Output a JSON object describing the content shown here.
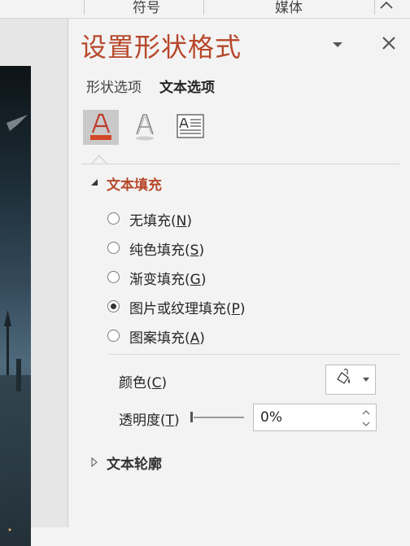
{
  "ribbon": {
    "group_symbols": "符号",
    "group_media": "媒体"
  },
  "pane": {
    "title": "设置形状格式",
    "tabs": [
      {
        "label": "形状选项",
        "active": false
      },
      {
        "label": "文本选项",
        "active": true
      }
    ],
    "icons": [
      "text-fill-outline-icon",
      "text-effects-icon",
      "textbox-icon"
    ],
    "accent_color": "#b7472a",
    "sections": {
      "text_fill": {
        "title": "文本填充",
        "expanded": true,
        "options": [
          {
            "label": "无填充",
            "key": "N",
            "selected": false
          },
          {
            "label": "纯色填充",
            "key": "S",
            "selected": false
          },
          {
            "label": "渐变填充",
            "key": "G",
            "selected": false
          },
          {
            "label": "图片或纹理填充",
            "key": "P",
            "selected": true
          },
          {
            "label": "图案填充",
            "key": "A",
            "selected": false
          }
        ],
        "color_label": "颜色",
        "color_key": "C",
        "transparency_label": "透明度",
        "transparency_key": "T",
        "transparency_value": "0%"
      },
      "text_outline": {
        "title": "文本轮廓",
        "expanded": false
      }
    }
  }
}
